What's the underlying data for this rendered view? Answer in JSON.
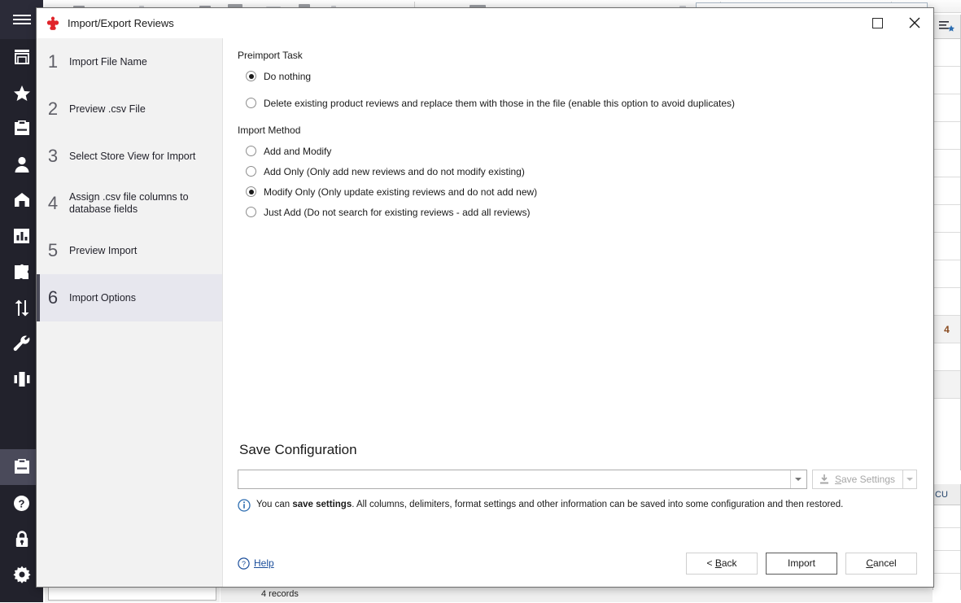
{
  "background": {
    "records_status": "4 records",
    "grid_cell_value": "4",
    "grid_header_icon": "list-star-icon",
    "right_panel_label": "CU"
  },
  "dialog": {
    "title": "Import/Export Reviews",
    "title_icon": "magento-logo-icon",
    "window_controls": {
      "maximize": "maximize-icon",
      "close": "close-icon"
    },
    "steps": [
      {
        "number": "1",
        "label": "Import File Name",
        "selected": false
      },
      {
        "number": "2",
        "label": "Preview .csv File",
        "selected": false
      },
      {
        "number": "3",
        "label": "Select Store View for Import",
        "selected": false
      },
      {
        "number": "4",
        "label": "Assign .csv file columns to database fields",
        "selected": false
      },
      {
        "number": "5",
        "label": "Preview Import",
        "selected": false
      },
      {
        "number": "6",
        "label": "Import Options",
        "selected": true
      }
    ],
    "preimport_task": {
      "title": "Preimport Task",
      "options": [
        {
          "label": "Do nothing",
          "checked": true
        },
        {
          "label": "Delete existing product reviews and replace them with those in the file (enable this option to avoid duplicates)",
          "checked": false
        }
      ]
    },
    "import_method": {
      "title": "Import Method",
      "options": [
        {
          "label": "Add and Modify",
          "checked": false
        },
        {
          "label": "Add Only (Only add new reviews  and do not modify existing)",
          "checked": false
        },
        {
          "label": "Modify Only (Only update existing reviews and do not add new)",
          "checked": true
        },
        {
          "label": "Just Add  (Do not search for existing reviews - add all reviews)",
          "checked": false
        }
      ]
    },
    "save_configuration": {
      "heading": "Save Configuration",
      "combo_value": "",
      "combo_placeholder": "",
      "save_settings_label": "Save Settings",
      "save_settings_accel": "S",
      "save_settings_icon": "download-icon",
      "save_settings_enabled": false,
      "info_icon": "info-icon",
      "info_text_before": "You can ",
      "info_text_bold": "save settings",
      "info_text_after": ". All columns, delimiters, format settings and other information can be saved into some configuration and then restored."
    },
    "footer": {
      "help_label": "Help",
      "help_icon": "question-circle-icon",
      "back_label": "< Back",
      "back_accel": "B",
      "import_label": "Import",
      "cancel_label": "Cancel",
      "cancel_accel": "C"
    }
  },
  "left_nav": {
    "menu_icon": "hamburger-icon",
    "items": [
      {
        "icon": "storefront-icon",
        "active": false
      },
      {
        "icon": "star-icon",
        "active": false
      },
      {
        "icon": "archive-box-icon",
        "active": false
      },
      {
        "icon": "person-icon",
        "active": false
      },
      {
        "icon": "shopping-bag-icon",
        "active": false
      },
      {
        "icon": "bar-chart-icon",
        "active": false
      },
      {
        "icon": "puzzle-piece-icon",
        "active": false
      },
      {
        "icon": "transfer-arrows-icon",
        "active": false
      },
      {
        "icon": "wrench-icon",
        "active": false
      },
      {
        "icon": "columns-icon",
        "active": false
      }
    ],
    "bottom_items": [
      {
        "icon": "archive-box-icon",
        "active": true
      },
      {
        "icon": "question-circle-icon",
        "active": false
      },
      {
        "icon": "lock-icon",
        "active": false
      },
      {
        "icon": "gear-icon",
        "active": false
      }
    ]
  },
  "colors": {
    "nav_background": "#22222c",
    "nav_active": "#4a4a5a",
    "step_selected_bg": "#e7e7ee",
    "step_marker": "#4a4a58",
    "link_blue": "#1b4e9b",
    "logo_red": "#e0242a"
  }
}
